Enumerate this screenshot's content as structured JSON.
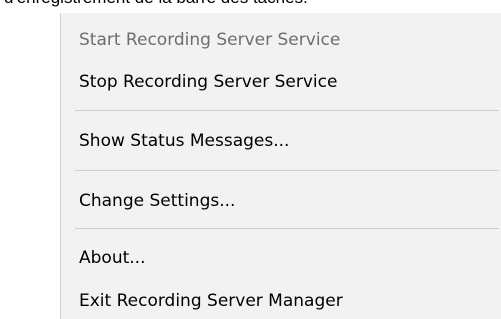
{
  "background_text": "d'enregistrement de la barre des tâches.",
  "menu": {
    "items": [
      {
        "label": "Start Recording Server Service",
        "disabled": true
      },
      {
        "label": "Stop Recording Server Service",
        "disabled": false
      },
      {
        "label": "Show Status Messages...",
        "disabled": false
      },
      {
        "label": "Change Settings...",
        "disabled": false
      },
      {
        "label": "About...",
        "disabled": false
      },
      {
        "label": "Exit Recording Server Manager",
        "disabled": false
      }
    ]
  },
  "colors": {
    "menu_background": "#f2f2f2",
    "separator": "#cfcfcf",
    "disabled_text": "#6d6d6d",
    "text": "#000000"
  }
}
